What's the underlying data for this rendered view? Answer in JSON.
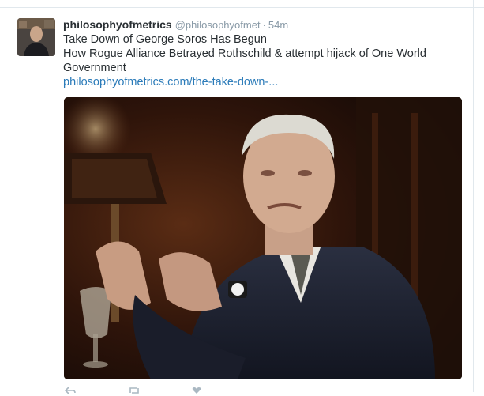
{
  "tweet": {
    "display_name": "philosophyofmetrics",
    "handle": "@philosophyofmet",
    "separator": "·",
    "time": "54m",
    "text_line_1": "Take Down of George Soros Has Begun",
    "text_line_2": "How Rogue Alliance Betrayed Rothschild & attempt hijack of One World Government",
    "link_text": "philosophyofmetrics.com/the-take-down-...",
    "avatar_icon": "user-avatar-icon",
    "media_icon": "photo-icon"
  },
  "actions": {
    "reply_icon": "reply-icon",
    "retweet_icon": "retweet-icon",
    "like_icon": "like-icon"
  },
  "colors": {
    "name": "#292f33",
    "meta": "#8899a6",
    "link": "#2b7bb9",
    "divider": "#e1e8ed"
  }
}
